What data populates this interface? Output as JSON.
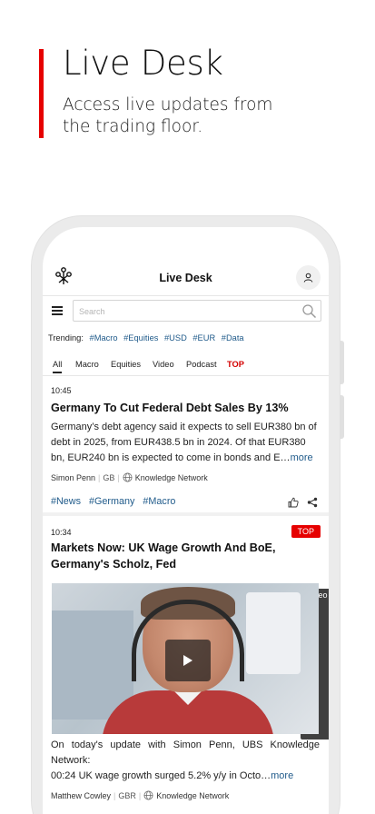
{
  "promo": {
    "title": "Live Desk",
    "subtitle": "Access live updates from the trading floor."
  },
  "app": {
    "title": "Live Desk",
    "search_placeholder": "Search"
  },
  "trending": {
    "label": "Trending:",
    "tags": [
      "#Macro",
      "#Equities",
      "#USD",
      "#EUR",
      "#Data"
    ]
  },
  "tabs": [
    "All",
    "Macro",
    "Equities",
    "Video",
    "Podcast",
    "TOP"
  ],
  "articles": [
    {
      "time": "10:45",
      "headline": "Germany To Cut Federal Debt Sales By 13%",
      "body": "Germany’s debt agency said it expects to sell EUR380 bn of debt in 2025, from EUR438.5 bn in 2024. Of that EUR380 bn, EUR240 bn is expected to come in bonds and E…",
      "more": "more",
      "author": "Simon Penn",
      "region": "GB",
      "source": "Knowledge Network",
      "hashtags": [
        "#News",
        "#Germany",
        "#Macro"
      ]
    },
    {
      "time": "10:34",
      "badges": [
        "TOP",
        "Video"
      ],
      "headline": "Markets Now: UK Wage Growth And BoE, Germany's Scholz, Fed",
      "body_line1": "On today's update with Simon Penn, UBS Knowledge Network:",
      "body_line2": "00:24 UK wage growth surged 5.2% y/y in Octo…",
      "more": "more",
      "author": "Matthew Cowley",
      "region": "GBR",
      "source": "Knowledge Network"
    }
  ],
  "colors": {
    "accent_red": "#e60000",
    "link_blue": "#1f5a8a"
  }
}
